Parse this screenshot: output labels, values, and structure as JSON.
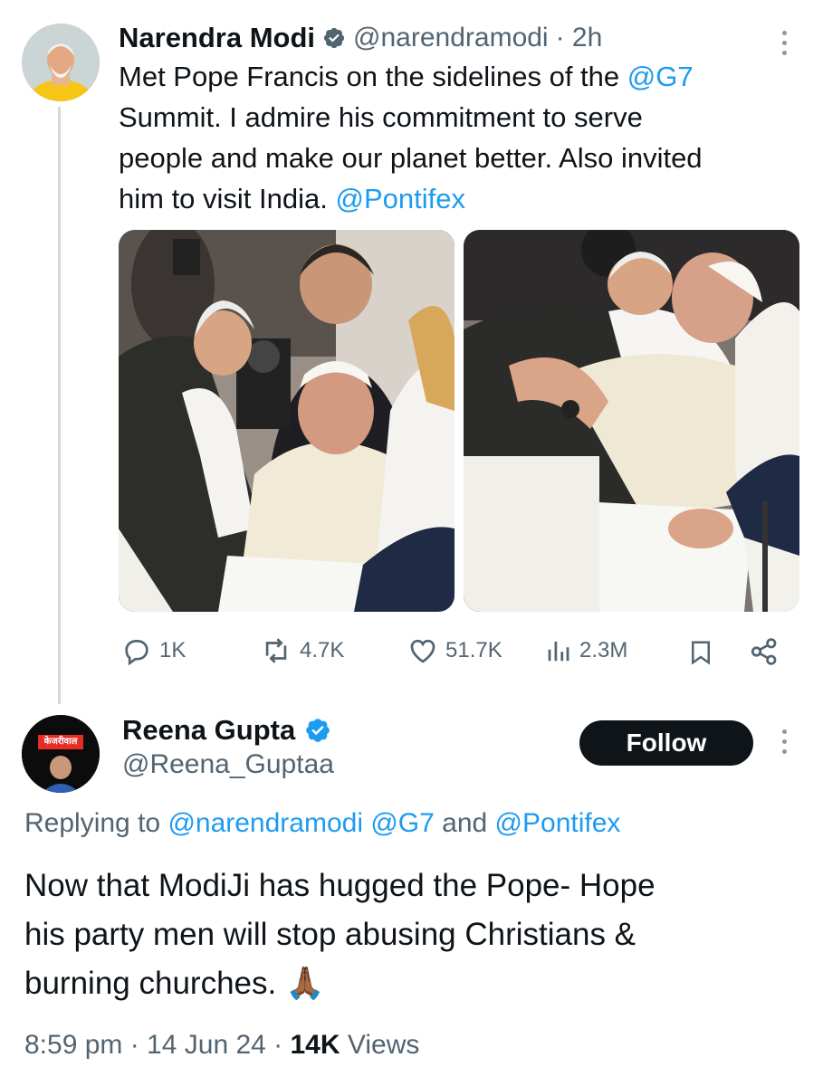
{
  "tweet": {
    "author_name": "Narendra Modi",
    "handle": "@narendramodi",
    "time": "· 2h",
    "text_parts": [
      "Met Pope Francis on the sidelines of the ",
      "@G7",
      "Summit. I admire his commitment to serve",
      "people and make our planet better. Also invited",
      "him to visit India. ",
      "@Pontifex"
    ],
    "actions": {
      "replies": "1K",
      "reposts": "4.7K",
      "likes": "51.7K",
      "views": "2.3M"
    }
  },
  "reply": {
    "author_name": "Reena Gupta",
    "handle": "@Reena_Guptaa",
    "follow_label": "Follow",
    "avatar_text": "केजरीवाल",
    "replying_to_prefix": "Replying to ",
    "replying_to_users": "@narendramodi @G7",
    "replying_to_and": " and ",
    "replying_to_last": "@Pontifex",
    "text_lines": [
      "Now that ModiJi has hugged the Pope- Hope",
      "his party men will stop abusing Christians &",
      "burning churches. 🙏🏾"
    ],
    "timestamp": "8:59 pm · 14 Jun 24 · ",
    "views_count": "14K",
    "views_label": " Views"
  },
  "colors": {
    "link": "#1d9bf0",
    "muted": "#536471",
    "verified": "#1d9bf0",
    "follow_bg": "#0f1419"
  },
  "icons": [
    "verified-badge-icon",
    "more-icon",
    "reply-icon",
    "repost-icon",
    "like-icon",
    "views-icon",
    "bookmark-icon",
    "share-icon"
  ]
}
